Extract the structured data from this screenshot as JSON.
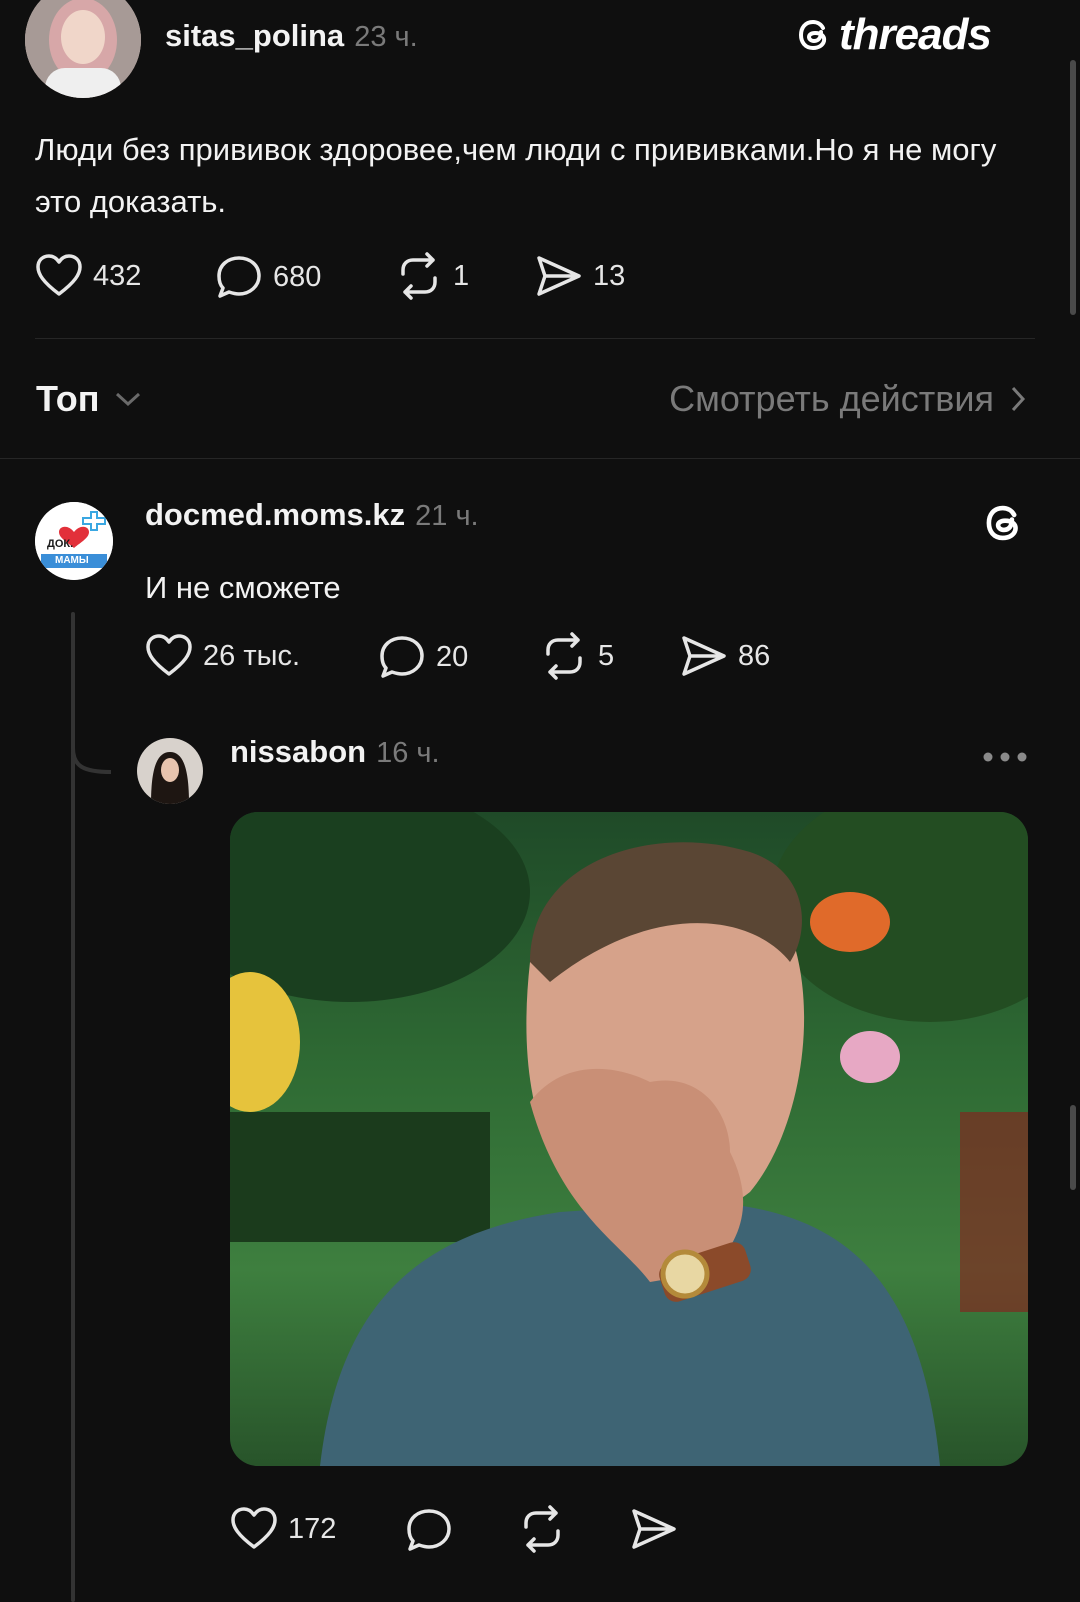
{
  "app": {
    "name": "threads"
  },
  "post": {
    "username": "sitas_polina",
    "time": "23 ч.",
    "text": "Люди без прививок здоровее,чем люди с прививками.Но я не могу это доказать.",
    "likes": "432",
    "comments": "680",
    "reposts": "1",
    "shares": "13"
  },
  "sort_bar": {
    "sort_label": "Топ",
    "activity_label": "Смотреть действия"
  },
  "reply1": {
    "username": "docmed.moms.kz",
    "time": "21 ч.",
    "text": "И не сможете",
    "likes": "26 тыс.",
    "comments": "20",
    "reposts": "5",
    "shares": "86",
    "avatar_text_top": "ДОК.",
    "avatar_text_bottom": "МАМЫ"
  },
  "reply2": {
    "username": "nissabon",
    "time": "16 ч.",
    "likes": "172",
    "image_icon": "photo-image"
  },
  "colors": {
    "background": "#0f0f0f",
    "secondary_text": "#7a7a7a",
    "divider": "#262626"
  }
}
